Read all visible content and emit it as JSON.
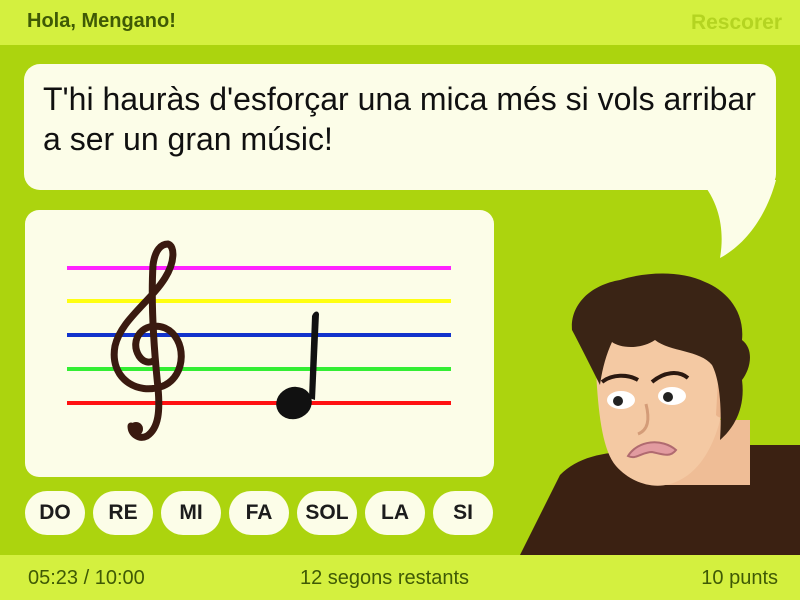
{
  "header": {
    "greeting": "Hola, Mengano!",
    "rescore_label": "Rescorer"
  },
  "message": {
    "text": "T'hi hauràs d'esforçar una mica més si vols arribar a ser un gran músic!"
  },
  "staff": {
    "line_colors": [
      "#ff22ff",
      "#ffff11",
      "#1133cc",
      "#33ee33",
      "#ff1111"
    ],
    "clef_icon": "treble-clef-icon",
    "note_icon": "quarter-note-icon"
  },
  "note_buttons": [
    {
      "label": "DO"
    },
    {
      "label": "RE"
    },
    {
      "label": "MI"
    },
    {
      "label": "FA"
    },
    {
      "label": "SOL"
    },
    {
      "label": "LA"
    },
    {
      "label": "SI"
    }
  ],
  "footer": {
    "timer": "05:23 / 10:00",
    "remaining": "12 segons restants",
    "score": "10 punts"
  },
  "colors": {
    "background": "#acd40e",
    "bar": "#d4f03f",
    "panel": "#fcfde8",
    "text_dark": "#3f5a05"
  }
}
